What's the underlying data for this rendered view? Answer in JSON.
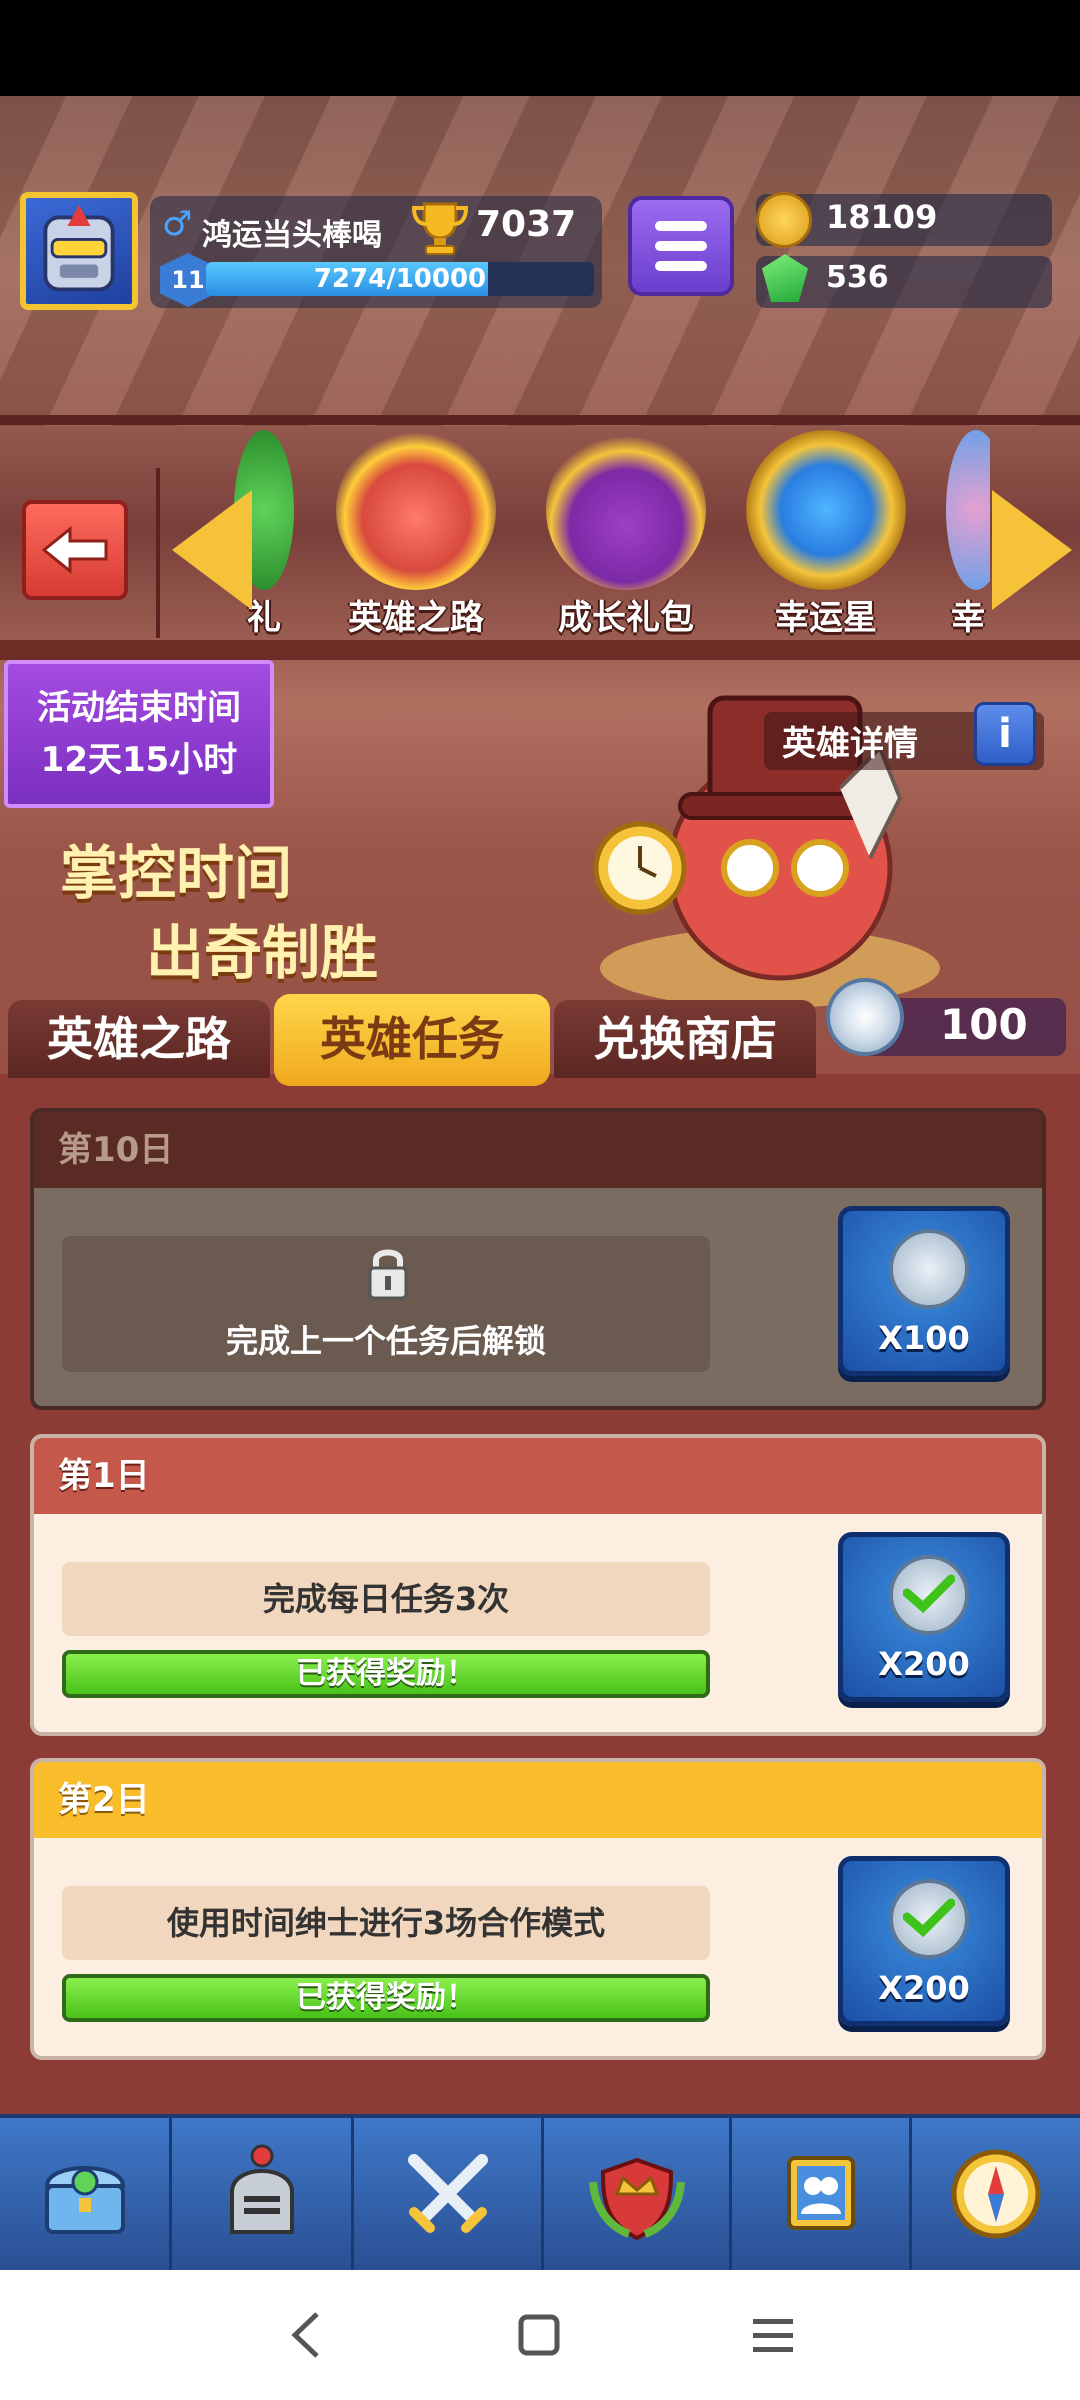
{
  "profile": {
    "player_name": "鸿运当头棒喝",
    "trophies": "7037",
    "level": "11",
    "xp_text": "7274/10000",
    "xp_fraction": 0.7274,
    "gender_icon": "male-symbol-icon"
  },
  "currency": {
    "coins": "18109",
    "gems": "536"
  },
  "carousel": {
    "items": [
      {
        "label": "礼"
      },
      {
        "label": "英雄之路"
      },
      {
        "label": "成长礼包"
      },
      {
        "label": "幸运星"
      },
      {
        "label": "幸"
      }
    ]
  },
  "banner": {
    "timer_title": "活动结束时间",
    "timer_value": "12天15小时",
    "slogan_line1": "掌控时间",
    "slogan_line2": "出奇制胜",
    "details_label": "英雄详情",
    "token_count": "100"
  },
  "tabs": [
    {
      "label": "英雄之路"
    },
    {
      "label": "英雄任务"
    },
    {
      "label": "兑换商店"
    }
  ],
  "tasks": [
    {
      "day": "第10日",
      "status": "locked",
      "description": "完成上一个任务后解锁",
      "reward": "X100"
    },
    {
      "day": "第1日",
      "status": "claimed",
      "description": "完成每日任务3次",
      "progress_text": "已获得奖励！",
      "progress": 1.0,
      "reward": "X200"
    },
    {
      "day": "第2日",
      "status": "claimed",
      "description": "使用时间绅士进行3场合作模式",
      "progress_text": "已获得奖励！",
      "progress": 1.0,
      "reward": "X200"
    }
  ],
  "bottom_nav": [
    {
      "icon": "treasure-chest-icon"
    },
    {
      "icon": "knight-helmet-icon"
    },
    {
      "icon": "crossed-swords-icon"
    },
    {
      "icon": "crown-shield-icon"
    },
    {
      "icon": "team-banner-icon"
    },
    {
      "icon": "compass-icon"
    }
  ],
  "colors": {
    "accent_gold": "#f0a91e",
    "locked_header": "#5a2a24",
    "day1_header": "#c4584a",
    "day2_header": "#f9bc2a",
    "progress_green": "#49c21a",
    "reward_blue": "#2a6ec8"
  }
}
